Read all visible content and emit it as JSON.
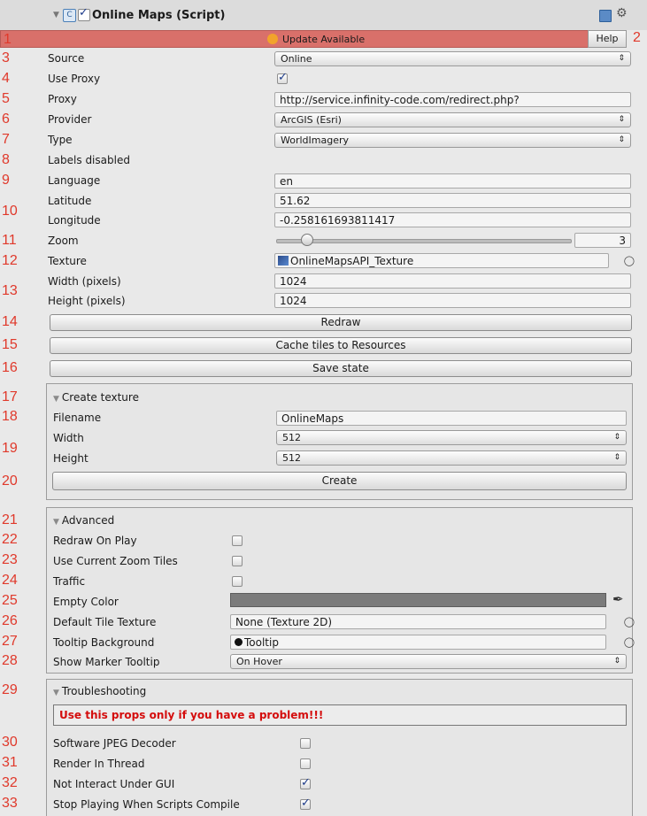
{
  "header": {
    "title": "Online Maps (Script)",
    "book_icon": "help-book-icon",
    "gear_icon": "gear-icon"
  },
  "update_bar": {
    "label": "Update Available",
    "help": "Help",
    "color": "#d9706a"
  },
  "numbers": [
    "1",
    "2",
    "3",
    "4",
    "5",
    "6",
    "7",
    "8",
    "9",
    "10",
    "11",
    "12",
    "13",
    "14",
    "15",
    "16",
    "17",
    "18",
    "19",
    "20",
    "21",
    "22",
    "23",
    "24",
    "25",
    "26",
    "27",
    "28",
    "29",
    "30",
    "31",
    "32",
    "33"
  ],
  "props": {
    "source": {
      "label": "Source",
      "value": "Online"
    },
    "use_proxy": {
      "label": "Use Proxy",
      "checked": true
    },
    "proxy": {
      "label": "Proxy",
      "value": "http://service.infinity-code.com/redirect.php?"
    },
    "provider": {
      "label": "Provider",
      "value": "ArcGIS (Esri)"
    },
    "type": {
      "label": "Type",
      "value": "WorldImagery"
    },
    "labels": {
      "label": "Labels disabled"
    },
    "language": {
      "label": "Language",
      "value": "en"
    },
    "latitude": {
      "label": "Latitude",
      "value": "51.62"
    },
    "longitude": {
      "label": "Longitude",
      "value": "-0.258161693811417"
    },
    "zoom": {
      "label": "Zoom",
      "value": "3",
      "slider_fraction": 0.1
    },
    "texture": {
      "label": "Texture",
      "value": "OnlineMapsAPI_Texture"
    },
    "width": {
      "label": "Width (pixels)",
      "value": "1024"
    },
    "height": {
      "label": "Height (pixels)",
      "value": "1024"
    }
  },
  "buttons": {
    "redraw": "Redraw",
    "cache": "Cache tiles to Resources",
    "save": "Save state"
  },
  "create_texture": {
    "title": "Create texture",
    "filename": {
      "label": "Filename",
      "value": "OnlineMaps"
    },
    "width": {
      "label": "Width",
      "value": "512"
    },
    "height": {
      "label": "Height",
      "value": "512"
    },
    "create": "Create"
  },
  "advanced": {
    "title": "Advanced",
    "redraw_on_play": {
      "label": "Redraw On Play",
      "checked": false
    },
    "use_current_zoom": {
      "label": "Use Current Zoom Tiles",
      "checked": false
    },
    "traffic": {
      "label": "Traffic",
      "checked": false
    },
    "empty_color": {
      "label": "Empty Color",
      "color": "#7b7b7b"
    },
    "default_tile": {
      "label": "Default Tile Texture",
      "value": "None (Texture 2D)"
    },
    "tooltip_bg": {
      "label": "Tooltip Background",
      "value": "Tooltip"
    },
    "show_marker": {
      "label": "Show Marker Tooltip",
      "value": "On Hover"
    }
  },
  "troubleshooting": {
    "title": "Troubleshooting",
    "warning": "Use this props only if you have a problem!!!",
    "jpeg": {
      "label": "Software JPEG Decoder",
      "checked": false
    },
    "thread": {
      "label": "Render In Thread",
      "checked": false
    },
    "not_interact": {
      "label": "Not Interact Under GUI",
      "checked": true
    },
    "stop_playing": {
      "label": "Stop Playing When Scripts Compile",
      "checked": true
    }
  }
}
